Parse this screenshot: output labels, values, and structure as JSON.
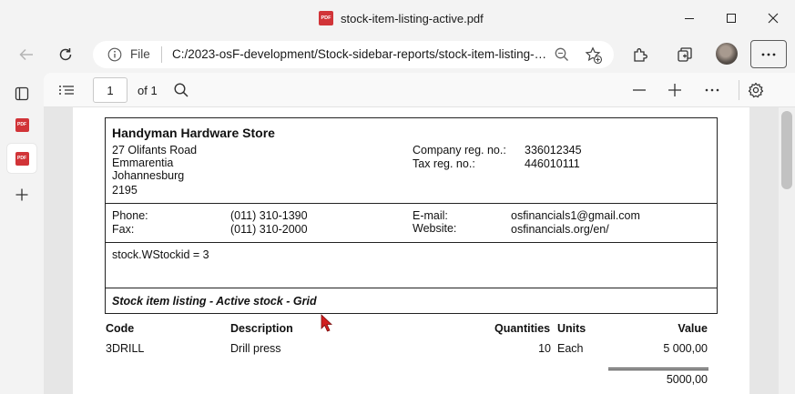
{
  "window": {
    "tab_title": "stock-item-listing-active.pdf",
    "pdf_icon_text": "PDF"
  },
  "address": {
    "scheme_label": "File",
    "url": "C:/2023-osF-development/Stock-sidebar-reports/stock-item-listing-active.pdf"
  },
  "pdf_toolbar": {
    "page_number": "1",
    "page_count_label": "of 1"
  },
  "report": {
    "company": {
      "name": "Handyman Hardware Store",
      "address_lines": [
        "27 Olifants Road",
        "Emmarentia",
        "Johannesburg",
        "2195"
      ],
      "reg_no_label": "Company reg. no.:",
      "reg_no": "336012345",
      "tax_no_label": "Tax reg. no.:",
      "tax_no": "446010111"
    },
    "contact": {
      "phone_label": "Phone:",
      "phone": "(011) 310-1390",
      "fax_label": "Fax:",
      "fax": "(011) 310-2000",
      "email_label": "E-mail:",
      "email": "osfinancials1@gmail.com",
      "website_label": "Website:",
      "website": "osfinancials.org/en/"
    },
    "filter": "stock.WStockid = 3",
    "title": "Stock item listing - Active stock - Grid",
    "columns": {
      "code": "Code",
      "description": "Description",
      "quantities": "Quantities",
      "units": "Units",
      "value": "Value"
    },
    "rows": [
      {
        "code": "3DRILL",
        "description": "Drill press",
        "quantities": "10",
        "units": "Each",
        "value": "5 000,00"
      }
    ],
    "total": "5000,00"
  },
  "colors": {
    "pdf_red": "#d13438",
    "chrome_bg": "#f3f3f3",
    "viewer_bg": "#e6e6e6",
    "cursor_red": "#d11f1f"
  }
}
